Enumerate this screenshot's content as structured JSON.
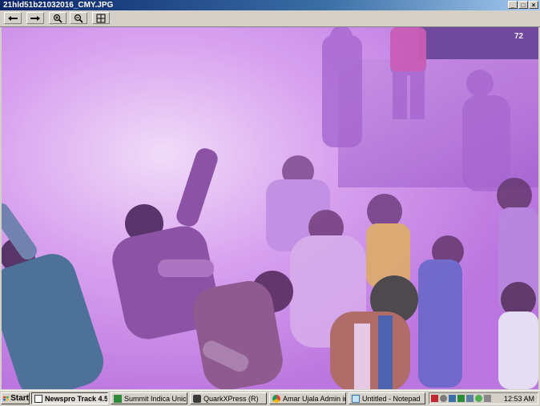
{
  "window": {
    "title": "21hld51b21032016_CMY.JPG",
    "controls": {
      "minimize": "_",
      "maximize": "□",
      "close": "×"
    }
  },
  "toolbar": {
    "buttons": [
      {
        "icon": "arrow-left-icon"
      },
      {
        "icon": "arrow-right-icon"
      },
      {
        "icon": "zoom-in-icon"
      },
      {
        "icon": "zoom-out-icon"
      },
      {
        "icon": "fit-window-icon"
      }
    ]
  },
  "photo": {
    "banner_numbers": "72",
    "dominant_color": "#c98be8"
  },
  "taskbar": {
    "start_label": "Start",
    "tasks": [
      {
        "label": "Newspro Track 4.5",
        "icon": "newspro-icon",
        "active": true
      },
      {
        "label": "Summit Indica Unicode",
        "icon": "summit-icon",
        "active": false
      },
      {
        "label": "QuarkXPress (R)",
        "icon": "quark-icon",
        "active": false
      },
      {
        "label": "Amar Ujala Admin in L...",
        "icon": "chrome-icon",
        "active": false
      },
      {
        "label": "Untitled - Notepad",
        "icon": "notepad-icon",
        "active": false
      }
    ],
    "clock": "12:53 AM"
  }
}
